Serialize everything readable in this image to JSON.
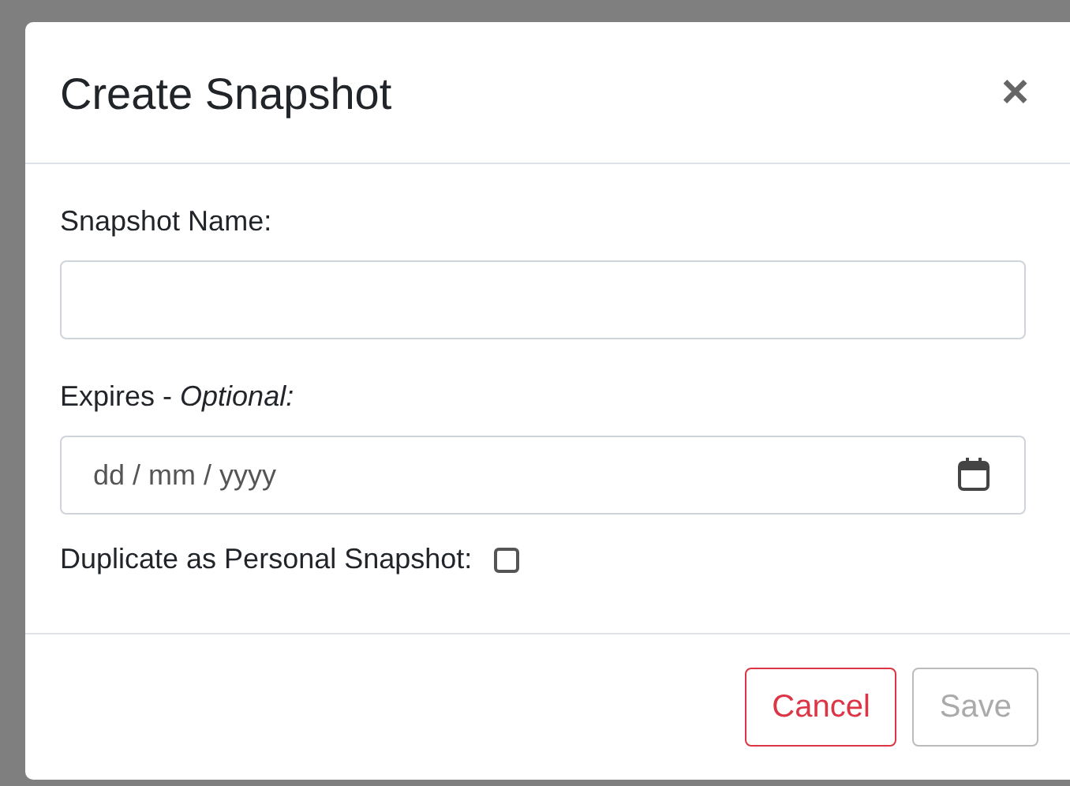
{
  "dialog": {
    "title": "Create Snapshot",
    "close": "×"
  },
  "fields": [
    {
      "kind": "text",
      "label": "Snapshot Name:"
    },
    {
      "kind": "date",
      "label": "Expires - *Optional:*",
      "placeholder": "dd / mm / yyyy"
    },
    {
      "kind": "checkbox",
      "label": "Duplicate as Personal Snapshot:",
      "checked": false
    }
  ],
  "buttons": [
    {
      "label": "Cancel",
      "kind": "danger",
      "disabled": false
    },
    {
      "label": "Save",
      "kind": "primary",
      "disabled": true
    }
  ]
}
